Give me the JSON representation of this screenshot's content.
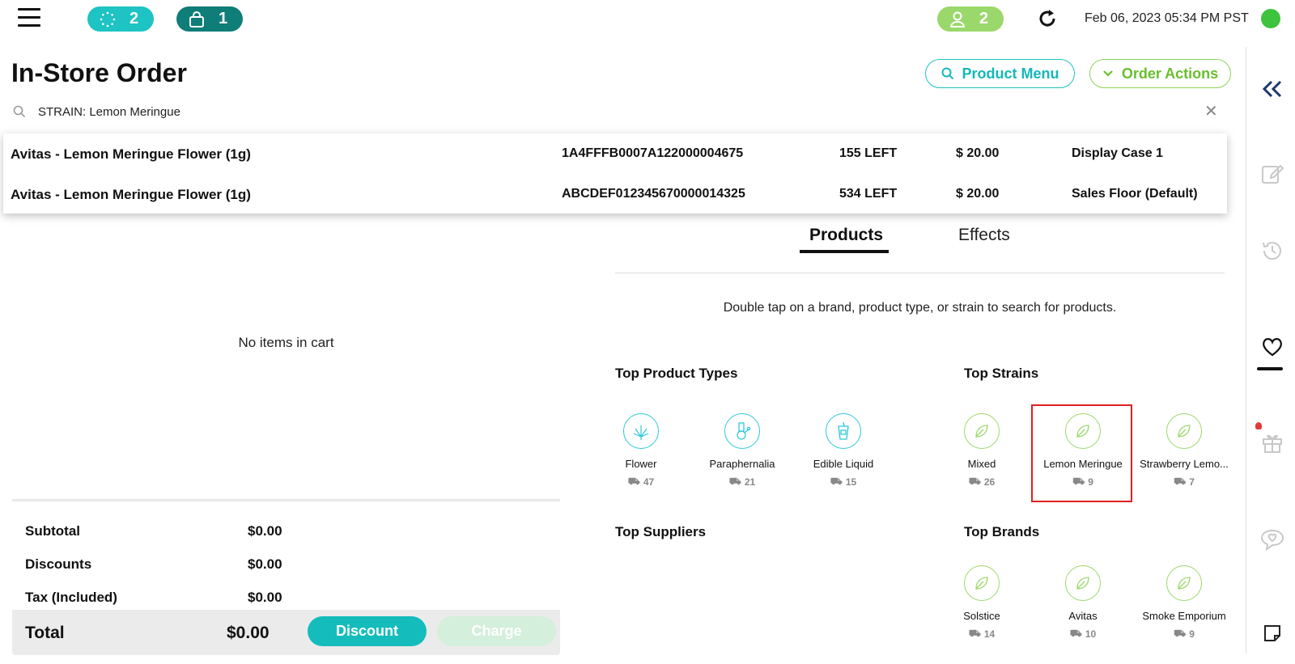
{
  "topbar": {
    "queue_count": "2",
    "bag_count": "1",
    "customers_count": "2",
    "datetime": "Feb 06, 2023 05:34 PM PST"
  },
  "page": {
    "title": "In-Store Order"
  },
  "header_buttons": {
    "product_menu": "Product Menu",
    "order_actions": "Order Actions"
  },
  "search": {
    "value": "STRAIN: Lemon Meringue",
    "placeholder": ""
  },
  "results": [
    {
      "name": "Avitas - Lemon Meringue Flower (1g)",
      "sku": "1A4FFFB0007A122000004675",
      "qty": "155 LEFT",
      "price": "$ 20.00",
      "location": "Display Case 1"
    },
    {
      "name": "Avitas - Lemon Meringue Flower (1g)",
      "sku": "ABCDEF012345670000014325",
      "qty": "534 LEFT",
      "price": "$ 20.00",
      "location": "Sales Floor (Default)"
    }
  ],
  "cart": {
    "empty_text": "No items in cart",
    "subtotal_label": "Subtotal",
    "subtotal": "$0.00",
    "discounts_label": "Discounts",
    "discounts": "$0.00",
    "tax_label": "Tax (Included)",
    "tax": "$0.00",
    "total_label": "Total",
    "total": "$0.00",
    "discount_button": "Discount",
    "charge_button": "Charge"
  },
  "products": {
    "tabs": [
      "Products",
      "Effects"
    ],
    "hint": "Double tap on a brand, product type, or strain to search for products.",
    "top_product_types_title": "Top Product Types",
    "top_strains_title": "Top Strains",
    "top_suppliers_title": "Top Suppliers",
    "top_brands_title": "Top Brands",
    "product_types": [
      {
        "label": "Flower",
        "count": "47",
        "icon": "cannabis-leaf-icon"
      },
      {
        "label": "Paraphernalia",
        "count": "21",
        "icon": "bong-icon"
      },
      {
        "label": "Edible Liquid",
        "count": "15",
        "icon": "drink-cup-icon"
      }
    ],
    "strains": [
      {
        "label": "Mixed",
        "count": "26",
        "icon": "leaf-icon"
      },
      {
        "label": "Lemon Meringue",
        "count": "9",
        "icon": "leaf-icon"
      },
      {
        "label": "Strawberry Lemo...",
        "count": "7",
        "icon": "leaf-icon"
      }
    ],
    "brands": [
      {
        "label": "Solstice",
        "count": "14",
        "icon": "leaf-icon"
      },
      {
        "label": "Avitas",
        "count": "10",
        "icon": "leaf-icon"
      },
      {
        "label": "Smoke Emporium",
        "count": "9",
        "icon": "leaf-icon"
      }
    ]
  },
  "colors": {
    "teal": "#1ec3c3",
    "dark_teal": "#0f7d78",
    "green": "#9bd86b",
    "status_online": "#3dc33d",
    "highlight_red": "#e02020"
  }
}
